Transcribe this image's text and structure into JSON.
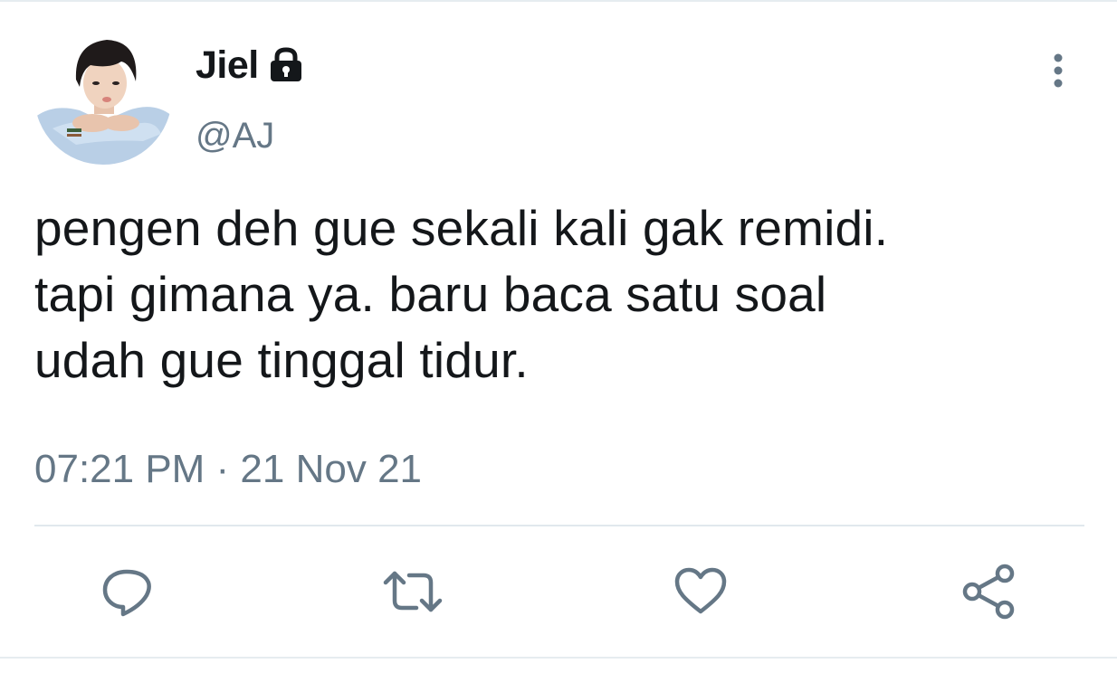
{
  "tweet": {
    "display_name": "Jiel",
    "handle": "@AJ",
    "text_lines": [
      "pengen deh gue sekali kali gak remidi.",
      "tapi gimana ya. baru baca satu soal",
      "udah gue tinggal tidur."
    ],
    "timestamp": "07:21 PM · 21 Nov 21",
    "protected_icon": "lock-icon",
    "menu_icon": "more-vertical-icon"
  },
  "actions": [
    {
      "name": "reply",
      "icon": "reply-icon"
    },
    {
      "name": "retweet",
      "icon": "retweet-icon"
    },
    {
      "name": "like",
      "icon": "heart-icon"
    },
    {
      "name": "share",
      "icon": "share-icon"
    }
  ],
  "colors": {
    "text_primary": "#14171a",
    "text_secondary": "#657786",
    "icon_gray": "#657786",
    "divider": "#e1e8ed"
  }
}
